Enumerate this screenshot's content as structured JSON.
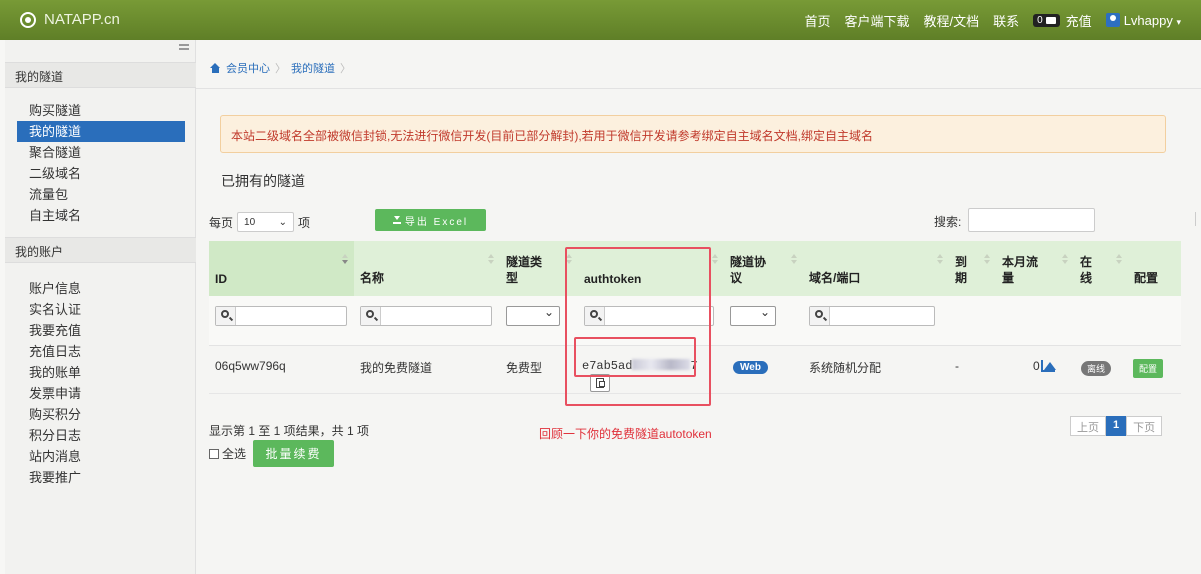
{
  "topbar": {
    "brand": "NATAPP.cn",
    "nav": [
      "首页",
      "客户端下载",
      "教程/文档",
      "联系"
    ],
    "balance": "0",
    "recharge": "充值",
    "user": "Lvhappy"
  },
  "sidebar": {
    "tunnels_header": "我的隧道",
    "tunnel_items": [
      "购买隧道",
      "我的隧道",
      "聚合隧道",
      "二级域名",
      "流量包",
      "自主域名"
    ],
    "active_item": "我的隧道",
    "account_header": "我的账户",
    "account_items": [
      "账户信息",
      "实名认证",
      "我要充值",
      "充值日志",
      "我的账单",
      "发票申请",
      "购买积分",
      "积分日志",
      "站内消息",
      "我要推广"
    ]
  },
  "breadcrumb": [
    "会员中心",
    "我的隧道"
  ],
  "alert": "本站二级域名全部被微信封锁,无法进行微信开发(目前已部分解封),若用于微信开发请参考绑定自主域名文档,绑定自主域名",
  "section_title": "已拥有的隧道",
  "controls": {
    "per_page_prefix": "每页",
    "per_page_value": "10",
    "per_page_suffix": "项",
    "export_label": "导出 Excel",
    "search_label": "搜索:"
  },
  "table": {
    "headers": [
      "ID",
      "名称",
      "隧道类型",
      "authtoken",
      "隧道协议",
      "域名/端口",
      "到期",
      "本月流量",
      "在线",
      "配置"
    ],
    "rows": [
      {
        "id": "06q5ww796q",
        "name": "我的免费隧道",
        "type": "免费型",
        "authtoken_visible": "e7ab5ad",
        "authtoken_tail": "7",
        "protocol": "Web",
        "domain": "系统随机分配",
        "expire": "-",
        "traffic": "0",
        "online": "离线",
        "config": "配置"
      }
    ]
  },
  "footer": {
    "result_text": "显示第 1 至 1 项结果，共 1 项",
    "select_all": "全选",
    "renew": "批量续费",
    "annotation": "回顾一下你的免费隧道autotoken",
    "prev": "上页",
    "page": "1",
    "next": "下页"
  },
  "colors": {
    "topbar": "#6b8c2f",
    "active": "#2a6ebb",
    "green_button": "#5cb85c",
    "highlight": "#e85060"
  }
}
